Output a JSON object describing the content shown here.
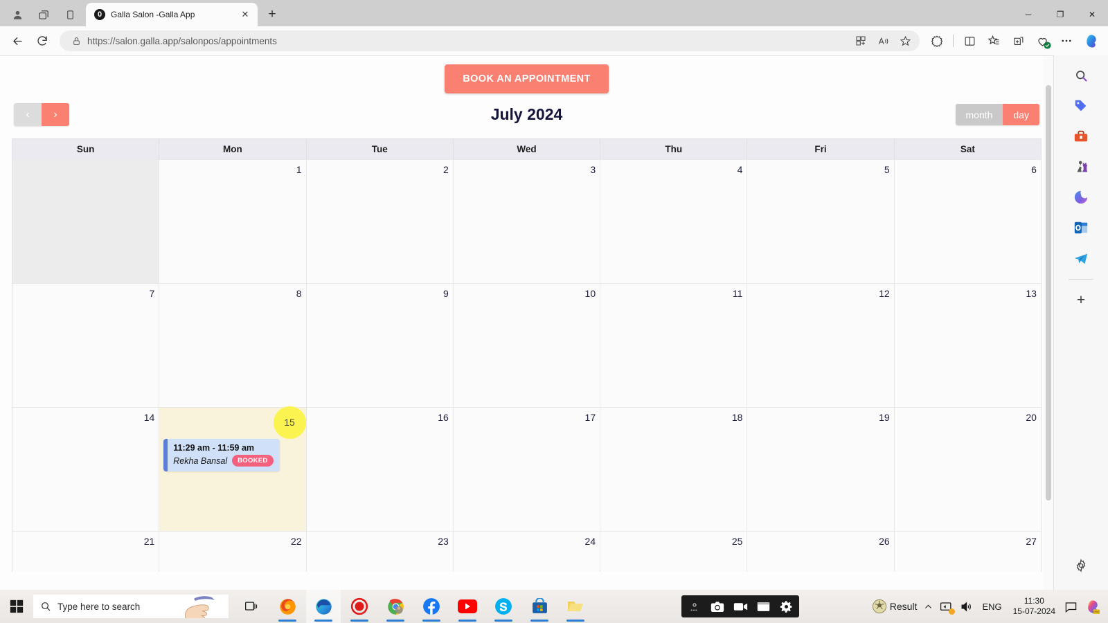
{
  "browser": {
    "tab": {
      "title": "Galla Salon -Galla App",
      "favicon": "galla-logo-icon",
      "close": "✕"
    },
    "newtab_label": "+",
    "window_controls": {
      "minimize": "─",
      "maximize": "❐",
      "close": "✕"
    },
    "url": {
      "full": "https://salon.galla.app/salonpos/appointments",
      "scheme": "https://",
      "host": "salon.galla.app",
      "path": "/salonpos/appointments"
    },
    "toolbar_icons": [
      "split-screen-icon",
      "read-aloud-icon",
      "favorite-star-icon",
      "browser-essentials-icon",
      "split-window-icon",
      "favorites-list-icon",
      "collections-icon",
      "health-check-icon",
      "settings-more-icon",
      "copilot-icon"
    ]
  },
  "app": {
    "book_button": "BOOK AN APPOINTMENT",
    "nav": {
      "prev": "‹",
      "next": "›"
    },
    "title": "July 2024",
    "views": {
      "month": "month",
      "day": "day",
      "active": "day"
    },
    "weekdays": [
      "Sun",
      "Mon",
      "Tue",
      "Wed",
      "Thu",
      "Fri",
      "Sat"
    ],
    "weeks": [
      [
        {
          "n": "",
          "blank": true
        },
        {
          "n": "1"
        },
        {
          "n": "2"
        },
        {
          "n": "3"
        },
        {
          "n": "4"
        },
        {
          "n": "5"
        },
        {
          "n": "6"
        }
      ],
      [
        {
          "n": "7"
        },
        {
          "n": "8"
        },
        {
          "n": "9"
        },
        {
          "n": "10"
        },
        {
          "n": "11"
        },
        {
          "n": "12"
        },
        {
          "n": "13"
        }
      ],
      [
        {
          "n": "14"
        },
        {
          "n": "15",
          "today": true
        },
        {
          "n": "16"
        },
        {
          "n": "17"
        },
        {
          "n": "18"
        },
        {
          "n": "19"
        },
        {
          "n": "20"
        }
      ],
      [
        {
          "n": "21"
        },
        {
          "n": "22"
        },
        {
          "n": "23"
        },
        {
          "n": "24"
        },
        {
          "n": "25"
        },
        {
          "n": "26"
        },
        {
          "n": "27"
        }
      ]
    ],
    "appointment": {
      "time": "11:29 am - 11:59 am",
      "client": "Rekha Bansal",
      "status": "BOOKED"
    },
    "colors": {
      "accent": "#fa8072",
      "today_bg": "#faf3dc",
      "today_circle": "#fbf34f",
      "event_bg": "#cfe0f8",
      "event_bar": "#5c7fd6",
      "badge": "#f4607d"
    }
  },
  "sidebar": {
    "items": [
      {
        "name": "search-icon"
      },
      {
        "name": "shopping-tag-icon"
      },
      {
        "name": "tools-toolbox-icon"
      },
      {
        "name": "games-icon"
      },
      {
        "name": "microsoft-365-icon"
      },
      {
        "name": "outlook-icon"
      },
      {
        "name": "telegram-icon"
      }
    ],
    "add_label": "+"
  },
  "taskbar": {
    "search_placeholder": "Type here to search",
    "apps": [
      "task-view-icon",
      "firefox-icon",
      "edge-icon",
      "record-app-icon",
      "chrome-icon",
      "facebook-icon",
      "youtube-icon",
      "skype-icon",
      "microsoft-store-icon",
      "folder-icon"
    ],
    "recorder": [
      "rec-settings-icon",
      "camera-icon",
      "video-icon",
      "window-icon",
      "gear-icon"
    ],
    "tray": {
      "app_label": "Result",
      "chevron": "⌃",
      "language": "ENG",
      "time": "11:30",
      "date": "15-07-2024"
    }
  }
}
